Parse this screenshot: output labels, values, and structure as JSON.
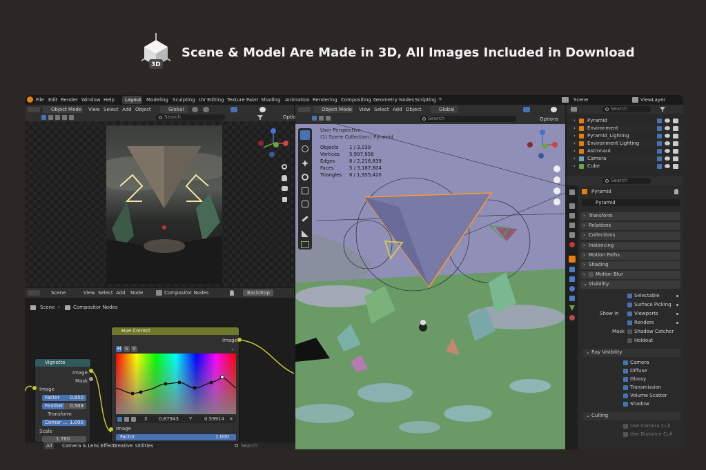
{
  "banner": {
    "title": "Scene & Model Are Made in 3D, All Images Included in Download",
    "badge": "3D"
  },
  "menubar": {
    "items": [
      "File",
      "Edit",
      "Render",
      "Window",
      "Help"
    ],
    "workspaces": [
      "Layout",
      "Modeling",
      "Sculpting",
      "UV Editing",
      "Texture Paint",
      "Shading",
      "Animation",
      "Rendering",
      "Compositing",
      "Geometry Nodes",
      "Scripting"
    ],
    "add": "+",
    "scene": "Scene",
    "viewlayer": "ViewLayer"
  },
  "image_editor": {
    "mode": "Object Mode",
    "menus": [
      "View",
      "Select",
      "Add",
      "Object"
    ],
    "orientation": "Global",
    "search": "Search",
    "options": "Optio"
  },
  "compositor": {
    "editor": "Scene",
    "menus": [
      "View",
      "Select",
      "Add",
      "Node"
    ],
    "tree": "Compositor Nodes",
    "backdrop": "Backdrop",
    "breadcrumb_scene": "Scene",
    "breadcrumb_tree": "Compositor Nodes",
    "vignette": {
      "title": "Vignette",
      "out_image": "Image",
      "out_mask": "Mask",
      "in_image": "Image",
      "factor_label": "Factor",
      "factor": "0.850",
      "feather_label": "Feather",
      "feather": "0.503",
      "transform": "Transform",
      "corner_label": "Corner ...",
      "corner": "1.000",
      "scale_label": "Scale",
      "scale": "1.760"
    },
    "hue": {
      "title": "Hue Correct",
      "out_image": "Image",
      "tabs": [
        "H",
        "S",
        "V"
      ],
      "x_label": "X",
      "x": "0.87943",
      "y_label": "Y",
      "y": "0.59914",
      "in_image": "Image",
      "factor_label": "Factor",
      "factor": "1.000"
    }
  },
  "viewport": {
    "mode": "Object Mode",
    "menus": [
      "View",
      "Select",
      "Add",
      "Object"
    ],
    "orientation": "Global",
    "search": "Search",
    "options": "Options",
    "title": "User Perspective",
    "collection": "(1) Scene Collection | Pyramid",
    "stats": [
      {
        "label": "Objects",
        "value": "1 / 3,039"
      },
      {
        "label": "Vertices",
        "value": "5,997,958"
      },
      {
        "label": "Edges",
        "value": "8 / 2,216,839"
      },
      {
        "label": "Faces",
        "value": "5 / 3,187,604"
      },
      {
        "label": "Triangles",
        "value": "6 / 1,955,420"
      }
    ]
  },
  "outliner": {
    "search": "Search",
    "items": [
      "Pyramid",
      "Environment",
      "Pyramid_Lighting",
      "Environment Lighting",
      "Astronaut",
      "Camera",
      "Cube"
    ]
  },
  "properties": {
    "search": "Search",
    "object": "Pyramid",
    "data_name": "Pyramid",
    "sections": [
      "Transform",
      "Relations",
      "Collections",
      "Instancing",
      "Motion Paths",
      "Shading",
      "Motion Blur",
      "Visibility"
    ],
    "visibility": {
      "selectable": "Selectable",
      "surface_picking": "Surface Picking",
      "show_in": "Show In",
      "viewports": "Viewports",
      "renders": "Renders",
      "mask": "Mask",
      "shadow_catcher": "Shadow Catcher",
      "holdout": "Holdout"
    },
    "ray_visibility": {
      "title": "Ray Visibility",
      "items": [
        "Camera",
        "Diffuse",
        "Glossy",
        "Transmission",
        "Volume Scatter",
        "Shadow"
      ]
    },
    "culling": {
      "title": "Culling",
      "items": [
        "Use Camera Cull",
        "Use Distance Cull"
      ]
    }
  },
  "assets": {
    "tabs": [
      "All",
      "Camera & Lens Effects",
      "Creative",
      "Utilities"
    ],
    "search": "Search"
  },
  "colors": {
    "accent": "#4772b3",
    "node_header_hue": "#6e7a2a",
    "node_header_vignette": "#305a5c",
    "socket": "#c7c729",
    "viewport_sky": "#8f8fb8",
    "ground": "#5e8a5a",
    "selection": "#ff9a2a"
  }
}
